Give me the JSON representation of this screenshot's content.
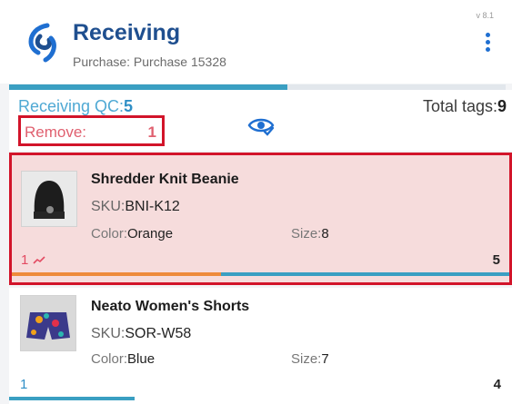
{
  "header": {
    "title": "Receiving",
    "subtitle": "Purchase: Purchase 15328",
    "version": "v 8.1",
    "menu_icon": "kebab-menu-icon",
    "brand_color": "#1f4f8f",
    "accent_color": "#1f6fd1"
  },
  "progress": {
    "fraction": 0.56,
    "color": "#3a9fc2"
  },
  "summary": {
    "qc_label": "Receiving QC:",
    "qc_value": "5",
    "total_label": "Total tags:",
    "total_value": "9",
    "remove_label": "Remove:",
    "remove_value": "1",
    "eye_icon": "eye-check-icon"
  },
  "items": [
    {
      "name": "Shredder Knit Beanie",
      "sku_label": "SKU:",
      "sku": "BNI-K12",
      "color_label": "Color:",
      "color": "Orange",
      "size_label": "Size:",
      "size": "8",
      "count_left": "1",
      "count_right": "5",
      "trend_icon": "trend-up-icon",
      "selected": true
    },
    {
      "name": "Neato Women's Shorts",
      "sku_label": "SKU:",
      "sku": "SOR-W58",
      "color_label": "Color:",
      "color": "Blue",
      "size_label": "Size:",
      "size": "7",
      "count_left": "1",
      "count_right": "4",
      "selected": false
    }
  ]
}
